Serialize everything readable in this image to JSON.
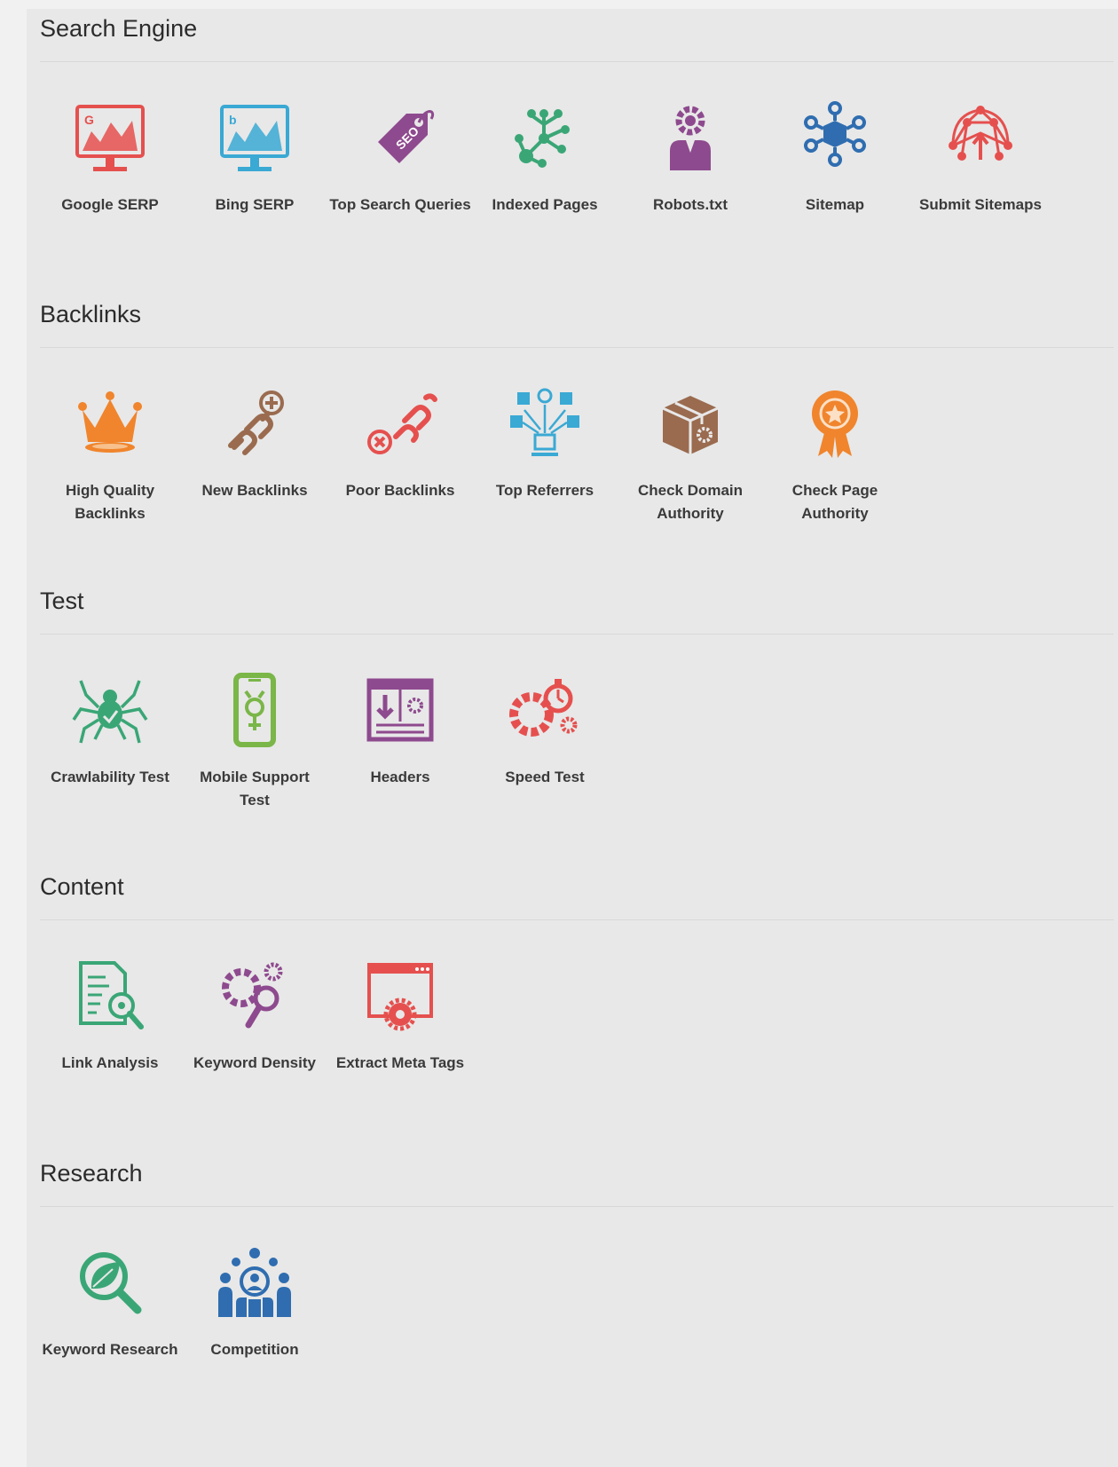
{
  "sections": [
    {
      "title": "Search Engine",
      "items": [
        {
          "label": "Google SERP",
          "icon": "google-serp-icon",
          "color": "#e5504e"
        },
        {
          "label": "Bing SERP",
          "icon": "bing-serp-icon",
          "color": "#3aa9d4"
        },
        {
          "label": "Top Search Queries",
          "icon": "seo-tag-icon",
          "color": "#8e4a8e"
        },
        {
          "label": "Indexed Pages",
          "icon": "network-tree-icon",
          "color": "#3aa676"
        },
        {
          "label": "Robots.txt",
          "icon": "robot-person-icon",
          "color": "#8e4a8e"
        },
        {
          "label": "Sitemap",
          "icon": "sitemap-hub-icon",
          "color": "#2f6db0"
        },
        {
          "label": "Submit Sitemaps",
          "icon": "submit-sitemap-icon",
          "color": "#e5504e"
        }
      ]
    },
    {
      "title": "Backlinks",
      "items": [
        {
          "label": "High Quality Backlinks",
          "icon": "crown-icon",
          "color": "#f0852d"
        },
        {
          "label": "New Backlinks",
          "icon": "chain-add-icon",
          "color": "#9a6b4f"
        },
        {
          "label": "Poor Backlinks",
          "icon": "chain-remove-icon",
          "color": "#e5504e"
        },
        {
          "label": "Top Referrers",
          "icon": "social-referrers-icon",
          "color": "#3aa9d4"
        },
        {
          "label": "Check Domain Authority",
          "icon": "box-gear-icon",
          "color": "#9a6b4f"
        },
        {
          "label": "Check Page Authority",
          "icon": "award-badge-icon",
          "color": "#f0852d"
        }
      ]
    },
    {
      "title": "Test",
      "items": [
        {
          "label": "Crawlability Test",
          "icon": "spider-icon",
          "color": "#3aa676"
        },
        {
          "label": "Mobile Support Test",
          "icon": "mobile-icon",
          "color": "#7ab648"
        },
        {
          "label": "Headers",
          "icon": "header-window-icon",
          "color": "#8e4a8e"
        },
        {
          "label": "Speed Test",
          "icon": "speed-gears-icon",
          "color": "#e5504e"
        }
      ]
    },
    {
      "title": "Content",
      "items": [
        {
          "label": "Link Analysis",
          "icon": "document-search-icon",
          "color": "#3aa676"
        },
        {
          "label": "Keyword Density",
          "icon": "gears-magnifier-icon",
          "color": "#8e4a8e"
        },
        {
          "label": "Extract Meta Tags",
          "icon": "window-gear-icon",
          "color": "#e5504e"
        }
      ]
    },
    {
      "title": "Research",
      "items": [
        {
          "label": "Keyword Research",
          "icon": "leaf-search-icon",
          "color": "#3aa676"
        },
        {
          "label": "Competition",
          "icon": "people-group-icon",
          "color": "#2f6db0"
        }
      ]
    }
  ]
}
